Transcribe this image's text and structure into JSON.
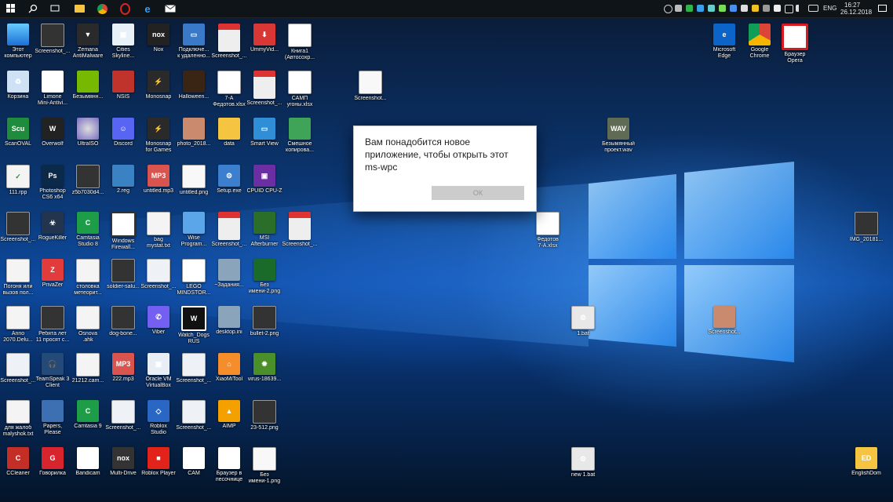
{
  "taskbar": {
    "language": "ENG",
    "time": "16:27",
    "date": "26.12.2018"
  },
  "dialog": {
    "message": "Вам понадобится новое приложение, чтобы открыть этот ms-wpc",
    "ok_label": "ОК"
  },
  "desktop": {
    "col1": [
      "Этот\nкомпьютер",
      "Корзина",
      "ScanOVAL",
      "111.rpp",
      "Screenshot_...",
      "Погоня или\nвызов пол...",
      "Anno\n2070.Delu...",
      "Screenshot_...",
      "для жалоб\nmalyshok.txt",
      "CCleaner"
    ],
    "col2": [
      "Screenshot_...",
      "Limone\nMini-Antivi...",
      "Overwolf",
      "Photoshop\nCS6 x64",
      "RogueKiller",
      "PrivaZer",
      "Ребята лет\n11 просят с...",
      "TeamSpeak 3\nClient",
      "Papers,\nPlease",
      "Говорилка"
    ],
    "col3": [
      "Zemana\nAntiMalware",
      "Безымянн...",
      "UltraISO",
      "z5b7030d4...",
      "Camtasia\nStudio 8",
      "столовка\nметеорит...",
      "Osnova\n.ahk",
      "21212.cam...",
      "Camtasia 9",
      "Bandicam"
    ],
    "col4": [
      "Cities\nSkyline...",
      "NSIS",
      "Discord",
      "2.reg",
      "Windows\nFirewall...",
      "soldier-salu...",
      "dog-bone...",
      "222.mp3",
      "Screenshot_...",
      "Multi-Drive"
    ],
    "col5": [
      "Nox",
      "Monosnap",
      "Monosnap\nfor Games",
      "untitled.mp3",
      "bag\nmystat.txt",
      "Screenshot_...",
      "Viber",
      "Oracle VM\nVirtualBox",
      "Roblox\nStudio",
      "Roblox Player"
    ],
    "col6": [
      "Подключе...\nк удаленно...",
      "Halloween...",
      "photo_2018...",
      "untitled.png",
      "Wise\nProgram...",
      "LEGO\nMINDSTOR...",
      "Watch_Dogs\nRUS",
      "Screenshot_...",
      "Screenshot_...",
      "CAM"
    ],
    "col7": [
      "Screenshot_...",
      "7-А\nФедотов.xlsx",
      "data",
      "Setup.exe",
      "Screenshot_...",
      "~Задания...",
      "desktop.ini",
      "XiaoMiTool",
      "AIMP",
      "Браузер в\nпесочнице"
    ],
    "col8": [
      "UmmyVid...",
      "Screenshot_...",
      "Smart View",
      "CPUID CPU-Z",
      "MSI\nAfterburner",
      "Без\nимени-2.png",
      "bullet-2.png",
      "virus-18639...",
      "23-512.png",
      "Без\nимени-1.png"
    ],
    "col9": [
      "Книга1\n(Автосохр...",
      "САМП\nугоны.xlsx",
      "Смешное\nкопирова...",
      "Screenshot_..."
    ],
    "extra": {
      "screenshot_top": "Screenshot...",
      "edge": "Microsoft\nEdge",
      "chrome": "Google\nChrome",
      "opera": "Браузер\nOpera",
      "wav": "Безымянный\nпроект.wav",
      "fedotov": "Федотов\n7-А.xlsx",
      "bat1": "1.bat",
      "screenshot_mid": "Screenshot...",
      "newbat": "new 1.bat",
      "img": "IMG_20181...",
      "englishdom": "EnglishDom"
    }
  }
}
